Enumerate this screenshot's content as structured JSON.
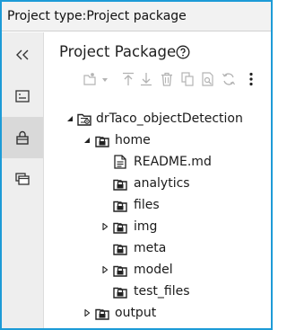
{
  "window": {
    "title": "Project type:Project package"
  },
  "panel": {
    "title": "Project Package"
  },
  "siderail": {
    "items": [
      {
        "name": "collapse",
        "icon": "double-chevron-left-icon"
      },
      {
        "name": "properties",
        "icon": "card-icon"
      },
      {
        "name": "project-package",
        "icon": "package-lock-icon",
        "active": true
      },
      {
        "name": "copies",
        "icon": "stacked-windows-icon"
      }
    ]
  },
  "toolbar": {
    "buttons": [
      {
        "icon": "new-item-icon",
        "has_dropdown": true
      },
      {
        "icon": "upload-icon"
      },
      {
        "icon": "download-icon"
      },
      {
        "icon": "delete-icon"
      },
      {
        "icon": "copy-icon"
      },
      {
        "icon": "find-icon"
      },
      {
        "icon": "refresh-icon"
      },
      {
        "icon": "more-icon"
      }
    ]
  },
  "tree": {
    "items": [
      {
        "label": "drTaco_objectDetection",
        "type": "project",
        "expanded": true
      },
      {
        "label": "home",
        "type": "folder-locked",
        "expanded": true
      },
      {
        "label": "README.md",
        "type": "file"
      },
      {
        "label": "analytics",
        "type": "folder-locked"
      },
      {
        "label": "files",
        "type": "folder-locked"
      },
      {
        "label": "img",
        "type": "folder-locked",
        "expanded": false
      },
      {
        "label": "meta",
        "type": "folder-locked"
      },
      {
        "label": "model",
        "type": "folder-locked",
        "expanded": false
      },
      {
        "label": "test_files",
        "type": "folder-locked"
      },
      {
        "label": "output",
        "type": "folder-locked",
        "expanded": false
      }
    ]
  },
  "colors": {
    "frame_border": "#1d9bd7",
    "titlebar_bg": "#f2f2f2",
    "siderail_bg": "#eeeeee",
    "siderail_active_bg": "#d9d9d9",
    "toolbar_disabled": "#b3b3b3",
    "text": "#1a1a1a"
  }
}
